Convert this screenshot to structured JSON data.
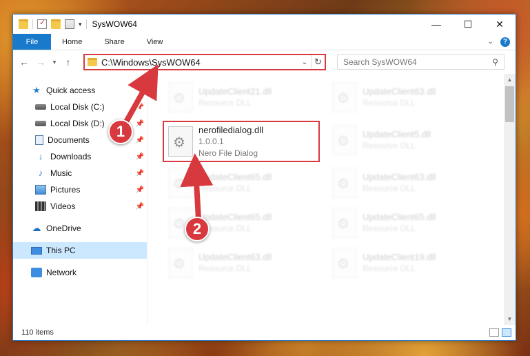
{
  "window": {
    "title": "SysWOW64",
    "controls": {
      "minimize": "—",
      "maximize": "☐",
      "close": "✕"
    }
  },
  "ribbon": {
    "tabs": [
      "File",
      "Home",
      "Share",
      "View"
    ]
  },
  "address": {
    "path": "C:\\Windows\\SysWOW64",
    "search_placeholder": "Search SysWOW64"
  },
  "sidebar": {
    "items": [
      {
        "label": "Quick access",
        "icon": "star-icon"
      },
      {
        "label": "Local Disk (C:)",
        "icon": "drive-icon",
        "pinned": true
      },
      {
        "label": "Local Disk (D:)",
        "icon": "drive-icon",
        "pinned": true
      },
      {
        "label": "Documents",
        "icon": "documents-icon",
        "pinned": true
      },
      {
        "label": "Downloads",
        "icon": "download-icon",
        "pinned": true
      },
      {
        "label": "Music",
        "icon": "music-icon",
        "pinned": true
      },
      {
        "label": "Pictures",
        "icon": "pictures-icon",
        "pinned": true
      },
      {
        "label": "Videos",
        "icon": "videos-icon",
        "pinned": true
      },
      {
        "label": "OneDrive",
        "icon": "cloud-icon"
      },
      {
        "label": "This PC",
        "icon": "computer-icon",
        "selected": true
      },
      {
        "label": "Network",
        "icon": "network-icon"
      }
    ]
  },
  "files": {
    "left": [
      {
        "name": "UpdateClient21.dll",
        "sub": "Resource DLL"
      },
      {
        "name": "nerofiledialog.dll",
        "version": "1.0.0.1",
        "sub": "Nero File Dialog"
      },
      {
        "name": "UpdateClient65.dll",
        "sub": "Resource DLL"
      },
      {
        "name": "UpdateClient65.dll",
        "sub": "Resource DLL"
      },
      {
        "name": "UpdateClient63.dll",
        "sub": "Resource DLL"
      }
    ],
    "right": [
      {
        "name": "UpdateClient63.dll",
        "sub": "Resource DLL"
      },
      {
        "name": "UpdateClient5.dll",
        "sub": "Resource DLL"
      },
      {
        "name": "UpdateClient63.dll",
        "sub": "Resource DLL"
      },
      {
        "name": "UpdateClient65.dll",
        "sub": "Resource DLL"
      },
      {
        "name": "UpdateClient19.dll",
        "sub": "Resource DLL"
      }
    ]
  },
  "status": {
    "items_count": "110 items"
  },
  "annotations": {
    "step1": "1",
    "step2": "2",
    "color": "#d8393f"
  }
}
